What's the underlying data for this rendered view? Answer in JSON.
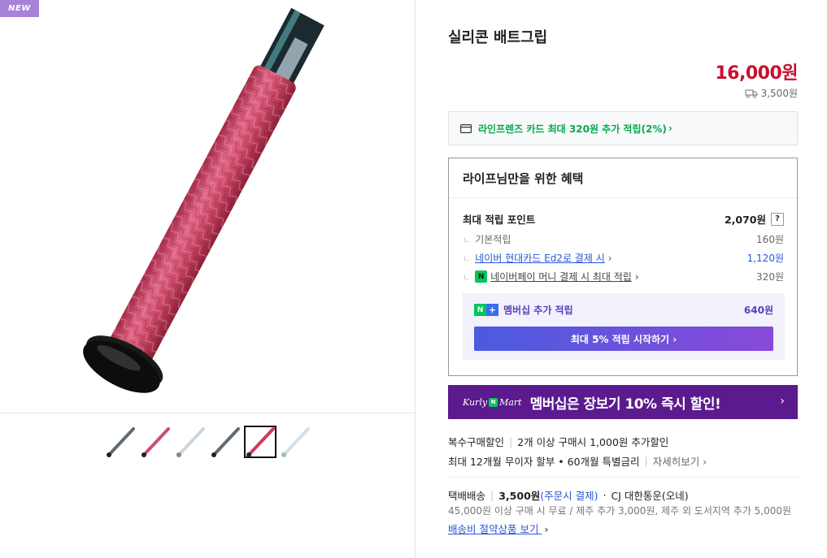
{
  "badge": "NEW",
  "product": {
    "title": "실리콘 배트그립",
    "price": "16,000원",
    "shipping_fee": "3,500원",
    "truck_icon": "truck-icon"
  },
  "card_benefit": {
    "text": "라인프렌즈 카드 최대 320원 추가 적립(2%)",
    "arrow": "›",
    "icon": "card-icon"
  },
  "benefits": {
    "title": "라이프님만을 위한 혜택",
    "max_point_label": "최대 적립 포인트",
    "max_point_value": "2,070원",
    "help": "?",
    "branch_glyph": "ㄴ",
    "rows": [
      {
        "label": "기본적립",
        "value": "160원"
      },
      {
        "label": "네이버 현대카드 Ed2로 결제 시",
        "arrow": "›",
        "value": "1,120원"
      },
      {
        "label": "네이버페이 머니 결제 시 최대 적립",
        "arrow": "›",
        "value": "320원",
        "icon_text": "N"
      }
    ],
    "membership": {
      "n": "N",
      "plus": "+",
      "label": "멤버십 추가 적립",
      "value": "640원",
      "cta": "최대 5% 적립 시작하기 ›"
    }
  },
  "kurly_banner": {
    "logo_left": "Kurly",
    "logo_n": "N",
    "logo_right": "Mart",
    "text": "멤버십은 장보기 10% 즉시 할인!",
    "arrow": "›"
  },
  "promo": {
    "multi_label": "복수구매할인",
    "multi_desc": "2개 이상 구매시 1,000원 추가할인",
    "installment": "최대 12개월 무이자 할부 • 60개월 특별금리",
    "details_link": "자세히보기 ›"
  },
  "delivery": {
    "label": "택배배송",
    "fee": "3,500원",
    "fee_note": "(주문시 결제)",
    "dot": "·",
    "carrier": "CJ 대한통운(오네)",
    "desc": "45,000원 이상 구매 시 무료 / 제주 추가 3,000원, 제주 외 도서지역 추가 5,000원",
    "link": "배송비 절약상품 보기",
    "link_arrow": "›"
  },
  "thumbnails": [
    {
      "color": "#5f6b78"
    },
    {
      "color": "#c9506b"
    },
    {
      "color": "#c9d6e2"
    },
    {
      "color": "#5f6b78"
    },
    {
      "color": "#d33a5c"
    },
    {
      "color": "#cfe0f0"
    }
  ],
  "colors": {
    "price": "#c8102e",
    "grip": "#cc4a68",
    "kurly": "#5c1a8f"
  }
}
